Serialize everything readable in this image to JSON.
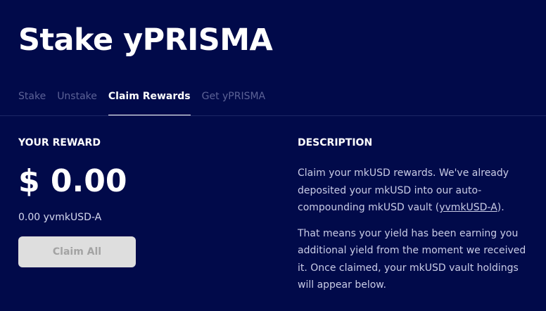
{
  "header": {
    "title": "Stake yPRISMA"
  },
  "tabs": [
    {
      "label": "Stake",
      "active": false
    },
    {
      "label": "Unstake",
      "active": false
    },
    {
      "label": "Claim Rewards",
      "active": true
    },
    {
      "label": "Get yPRISMA",
      "active": false
    }
  ],
  "reward": {
    "heading": "YOUR REWARD",
    "amount": "$ 0.00",
    "token_amount": "0.00 yvmkUSD-A",
    "claim_button": "Claim All"
  },
  "description": {
    "heading": "DESCRIPTION",
    "p1_before": "Claim your mkUSD rewards. We've already deposited your mkUSD into our auto-compounding mkUSD vault (",
    "p1_link": "yvmkUSD-A",
    "p1_after": ").",
    "p2": "That means your yield has been earning you additional yield from the moment we received it. Once claimed, your mkUSD vault holdings will appear below."
  },
  "colors": {
    "background": "#010a4a",
    "tab_inactive": "#5c6296",
    "button_disabled_bg": "#dedede",
    "button_disabled_text": "#a3a3a3"
  }
}
